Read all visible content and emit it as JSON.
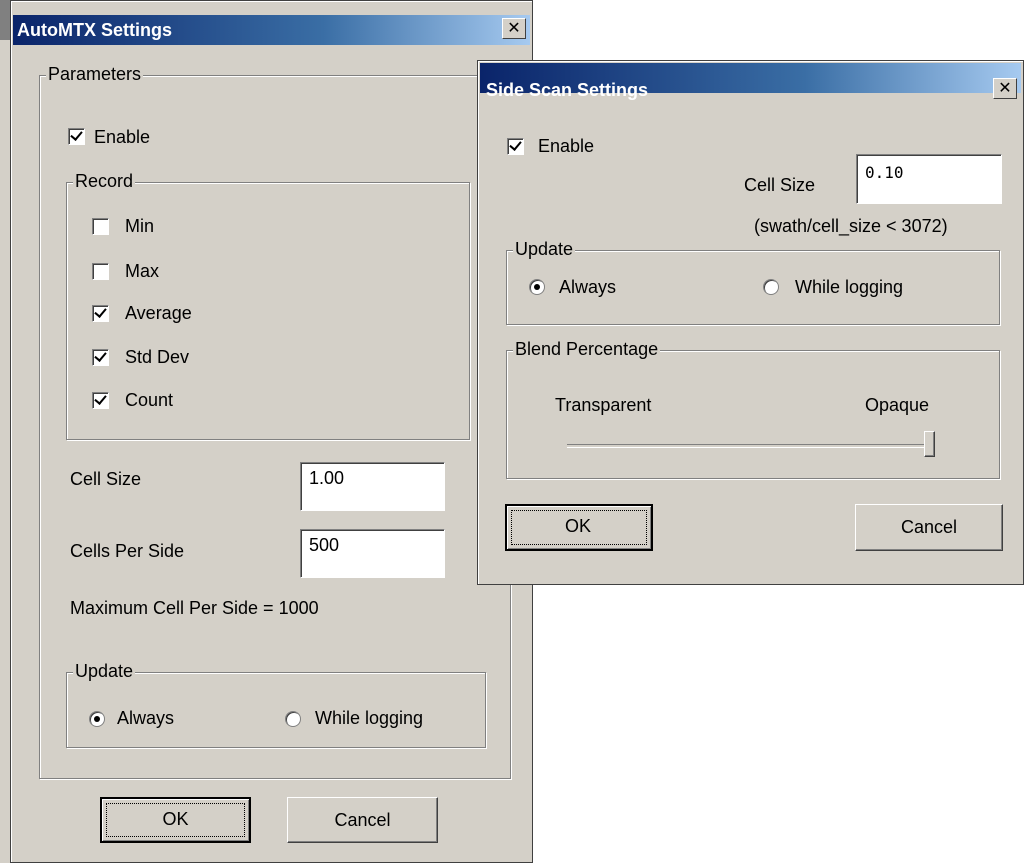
{
  "automtx": {
    "title": "AutoMTX Settings",
    "close": "✕",
    "parameters_label": "Parameters",
    "enable_label": "Enable",
    "enable_checked": true,
    "record_label": "Record",
    "record_items": [
      {
        "label": "Min",
        "checked": false
      },
      {
        "label": "Max",
        "checked": false
      },
      {
        "label": "Average",
        "checked": true
      },
      {
        "label": "Std Dev",
        "checked": true
      },
      {
        "label": "Count",
        "checked": true
      }
    ],
    "cell_size_label": "Cell Size",
    "cell_size_value": "1.00",
    "cells_per_side_label": "Cells Per Side",
    "cells_per_side_value": "500",
    "max_cells_text": "Maximum Cell Per Side =  1000",
    "update_label": "Update",
    "update_options": [
      "Always",
      "While logging"
    ],
    "update_selected": 0,
    "ok_label": "OK",
    "cancel_label": "Cancel"
  },
  "sidescan": {
    "title": "Side Scan Settings",
    "close": "✕",
    "enable_label": "Enable",
    "enable_checked": true,
    "cell_size_label": "Cell Size",
    "cell_size_value": "0.10",
    "constraint_text": "(swath/cell_size  < 3072)",
    "update_label": "Update",
    "update_options": [
      "Always",
      "While logging"
    ],
    "update_selected": 0,
    "blend_label": "Blend Percentage",
    "blend_min_label": "Transparent",
    "blend_max_label": "Opaque",
    "blend_value_percent": 100,
    "ok_label": "OK",
    "cancel_label": "Cancel"
  },
  "colors": {
    "dialog_bg": "#d4d0c8",
    "title_start": "#0a246a",
    "title_end": "#a6caf0"
  }
}
